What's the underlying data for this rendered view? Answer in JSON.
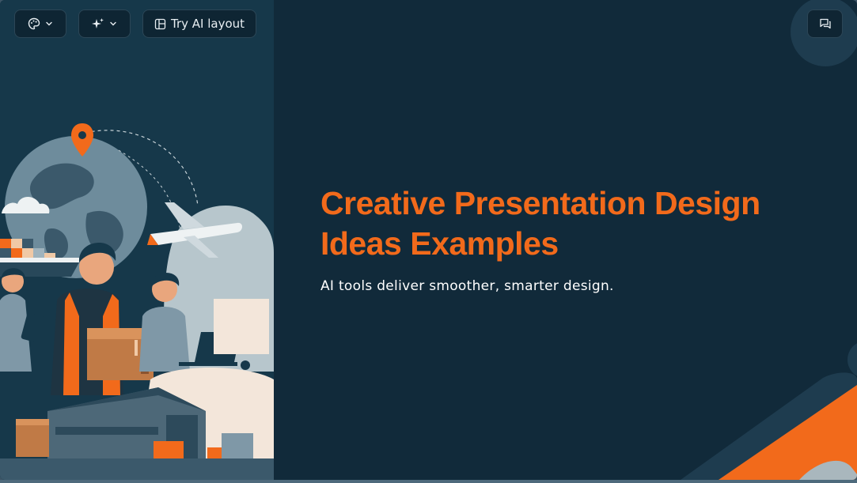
{
  "toolbar": {
    "theme_icon": "palette-icon",
    "ai_icon": "sparkles-icon",
    "layout_icon": "layout-icon",
    "layout_label": "Try AI layout",
    "comment_icon": "comment-icon"
  },
  "slide": {
    "title_line1": "Creative Presentation Design",
    "title_line2": "Ideas Examples",
    "subtitle": "AI tools deliver smoother, smarter design."
  },
  "colors": {
    "background": "#112a3a",
    "accent": "#f26a1b",
    "text": "#ffffff"
  }
}
